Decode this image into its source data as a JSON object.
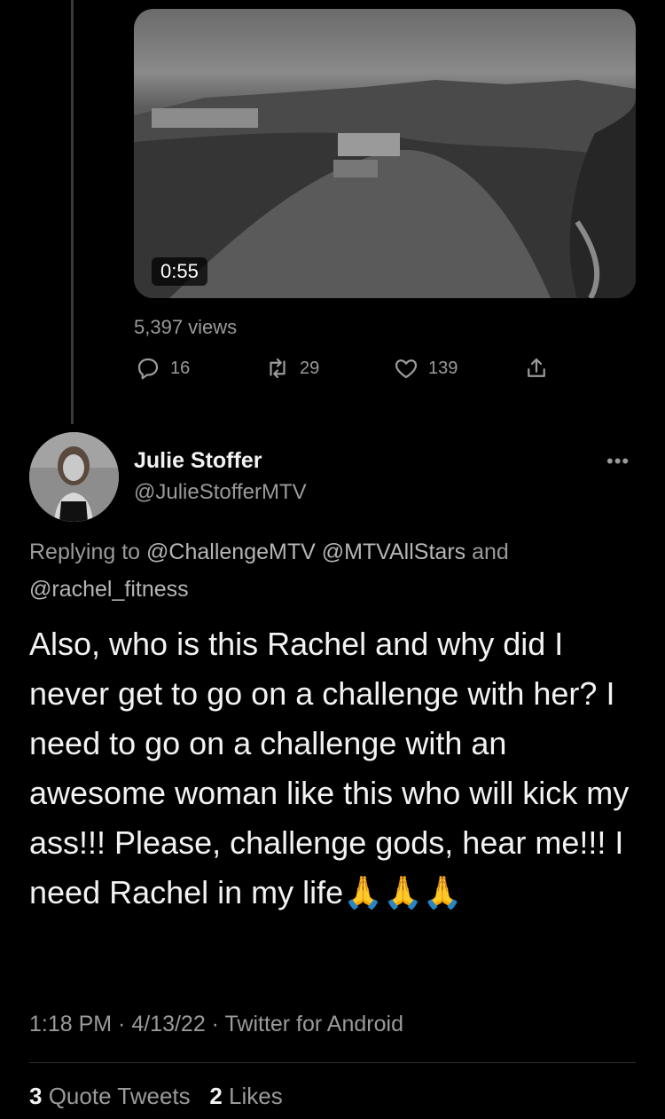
{
  "video": {
    "duration": "0:55",
    "views": "5,397 views"
  },
  "actions": {
    "replies": "16",
    "retweets": "29",
    "likes": "139"
  },
  "reply_tweet": {
    "name": "Julie Stoffer",
    "handle": "@JulieStofferMTV",
    "more": "•••",
    "replying_prefix": "Replying to",
    "replying_mentions": "@ChallengeMTV @MTVAllStars",
    "replying_and": "and",
    "replying_last": "@rachel_fitness",
    "text": "Also, who is this Rachel and why did I never get to go on a challenge with her? I need to go on a challenge with an awesome woman like this who will kick my ass!!! Please, challenge gods, hear me!!! I need Rachel in my life🙏🙏🙏",
    "meta": "1:18 PM · 4/13/22 · Twitter for Android",
    "quote_count": "3",
    "quote_label": "Quote Tweets",
    "like_count": "2",
    "like_label": "Likes"
  }
}
